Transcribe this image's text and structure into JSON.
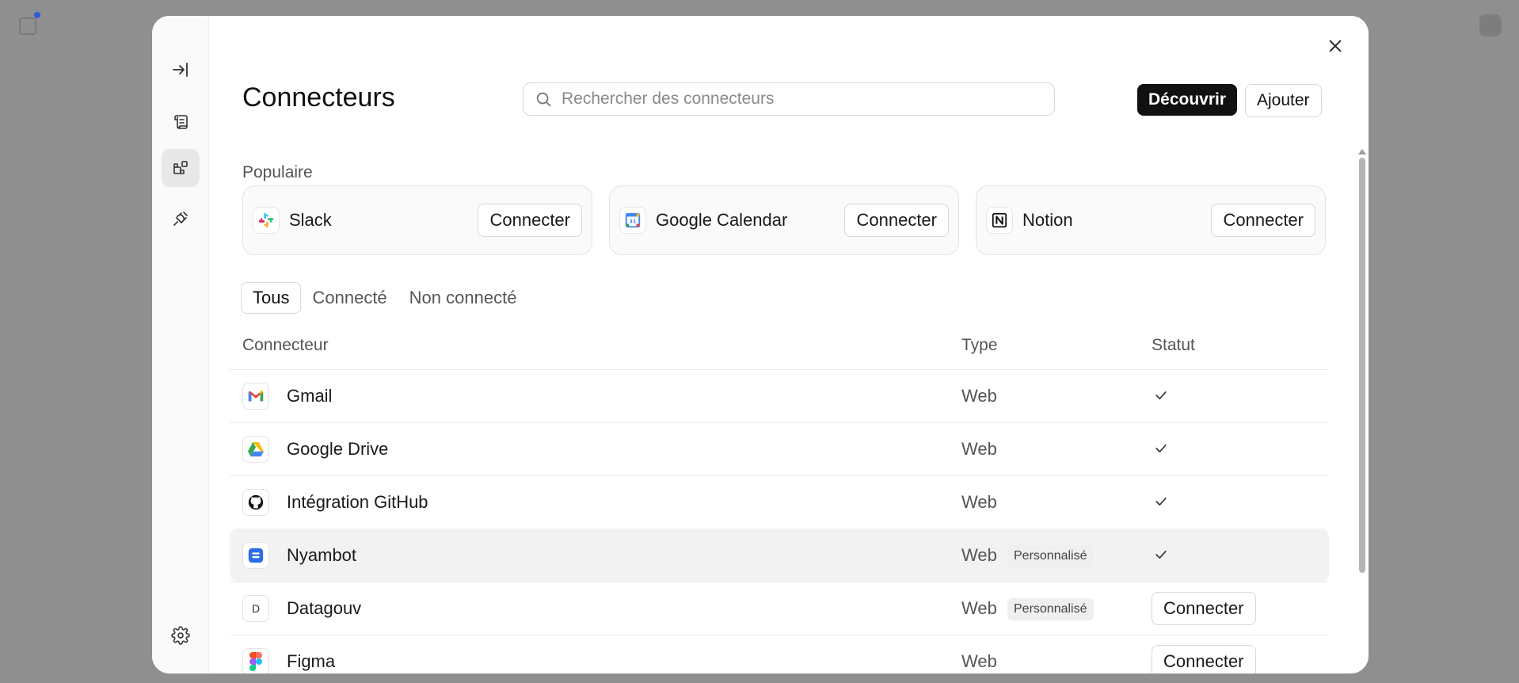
{
  "dialog": {
    "title": "Connecteurs",
    "search_placeholder": "Rechercher des connecteurs",
    "discover_label": "Découvrir",
    "add_label": "Ajouter"
  },
  "popular": {
    "label": "Populaire",
    "cards": [
      {
        "name": "Slack",
        "icon": "slack-logo",
        "action": "Connecter"
      },
      {
        "name": "Google Calendar",
        "icon": "google-calendar-logo",
        "action": "Connecter"
      },
      {
        "name": "Notion",
        "icon": "notion-logo",
        "action": "Connecter"
      }
    ]
  },
  "filters": [
    {
      "label": "Tous",
      "active": true
    },
    {
      "label": "Connecté",
      "active": false
    },
    {
      "label": "Non connecté",
      "active": false
    }
  ],
  "table": {
    "headers": {
      "connector": "Connecteur",
      "type": "Type",
      "status": "Statut"
    },
    "rows": [
      {
        "name": "Gmail",
        "type": "Web",
        "badge": "",
        "status": "connected",
        "icon": "gmail-logo"
      },
      {
        "name": "Google Drive",
        "type": "Web",
        "badge": "",
        "status": "connected",
        "icon": "google-drive-logo"
      },
      {
        "name": "Intégration GitHub",
        "type": "Web",
        "badge": "",
        "status": "connected",
        "icon": "github-logo"
      },
      {
        "name": "Nyambot",
        "type": "Web",
        "badge": "Personnalisé",
        "status": "connected",
        "icon": "nyambot-logo"
      },
      {
        "name": "Datagouv",
        "type": "Web",
        "badge": "Personnalisé",
        "status": "Connecter",
        "icon": "letter-d",
        "letter": "D"
      },
      {
        "name": "Figma",
        "type": "Web",
        "badge": "",
        "status": "Connecter",
        "icon": "figma-logo"
      }
    ]
  }
}
